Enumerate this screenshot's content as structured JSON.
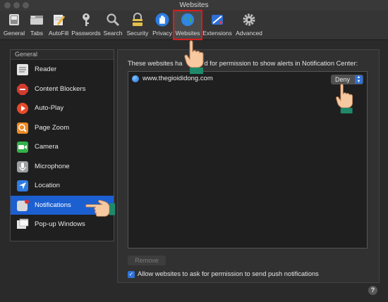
{
  "window": {
    "title": "Websites"
  },
  "toolbar": {
    "items": [
      {
        "label": "General",
        "icon": "general-switch-icon"
      },
      {
        "label": "Tabs",
        "icon": "tabs-icon"
      },
      {
        "label": "AutoFill",
        "icon": "pencil-icon"
      },
      {
        "label": "Passwords",
        "icon": "key-icon"
      },
      {
        "label": "Search",
        "icon": "search-icon"
      },
      {
        "label": "Security",
        "icon": "lock-icon"
      },
      {
        "label": "Privacy",
        "icon": "hand-icon"
      },
      {
        "label": "Websites",
        "icon": "globe-icon"
      },
      {
        "label": "Extensions",
        "icon": "puzzle-icon"
      },
      {
        "label": "Advanced",
        "icon": "gear-icon"
      }
    ],
    "selected": "Websites"
  },
  "sidebar": {
    "header": "General",
    "items": [
      {
        "label": "Reader",
        "icon": "reader-icon",
        "color": "#e4e4e4"
      },
      {
        "label": "Content Blockers",
        "icon": "stop-sign-icon",
        "color": "#d33b2f"
      },
      {
        "label": "Auto-Play",
        "icon": "play-icon",
        "color": "#e54a2a"
      },
      {
        "label": "Page Zoom",
        "icon": "zoom-icon",
        "color": "#f08a24"
      },
      {
        "label": "Camera",
        "icon": "camera-icon",
        "color": "#35b24a"
      },
      {
        "label": "Microphone",
        "icon": "microphone-icon",
        "color": "#9ea0a3"
      },
      {
        "label": "Location",
        "icon": "location-arrow-icon",
        "color": "#2e7ce4"
      },
      {
        "label": "Notifications",
        "icon": "notifications-icon",
        "color": "#d8d8d8"
      },
      {
        "label": "Pop-up Windows",
        "icon": "popup-window-icon",
        "color": "#e6e6e6"
      }
    ],
    "selected": "Notifications"
  },
  "panel": {
    "description": "These websites have asked for permission to show alerts in Notification Center:",
    "description_visible_start": "These websites ha",
    "description_visible_end": "d for permission to show alerts in Notification Center:",
    "sites": [
      {
        "domain": "www.thegioididong.com",
        "permission": "Deny"
      }
    ],
    "remove_label": "Remove",
    "allow_checkbox": {
      "checked": true,
      "label": "Allow websites to ask for permission to send push notifications"
    }
  },
  "colors": {
    "accent": "#2f72d8",
    "selection": "#1b5fd0",
    "highlight_box": "#d81d1d",
    "hand_cuff": "#1f8a6a"
  }
}
